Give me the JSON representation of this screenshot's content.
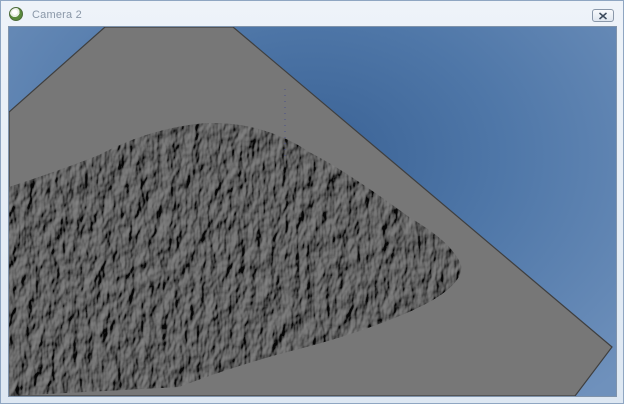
{
  "window": {
    "title": "Camera 2"
  },
  "icons": {
    "app": "app-icon",
    "close": "close-icon"
  },
  "colors": {
    "sky_top": "#3a6295",
    "sky_edge": "#6f91bc",
    "terrain": "#777777",
    "terrain_edge": "#3f3f3f"
  }
}
